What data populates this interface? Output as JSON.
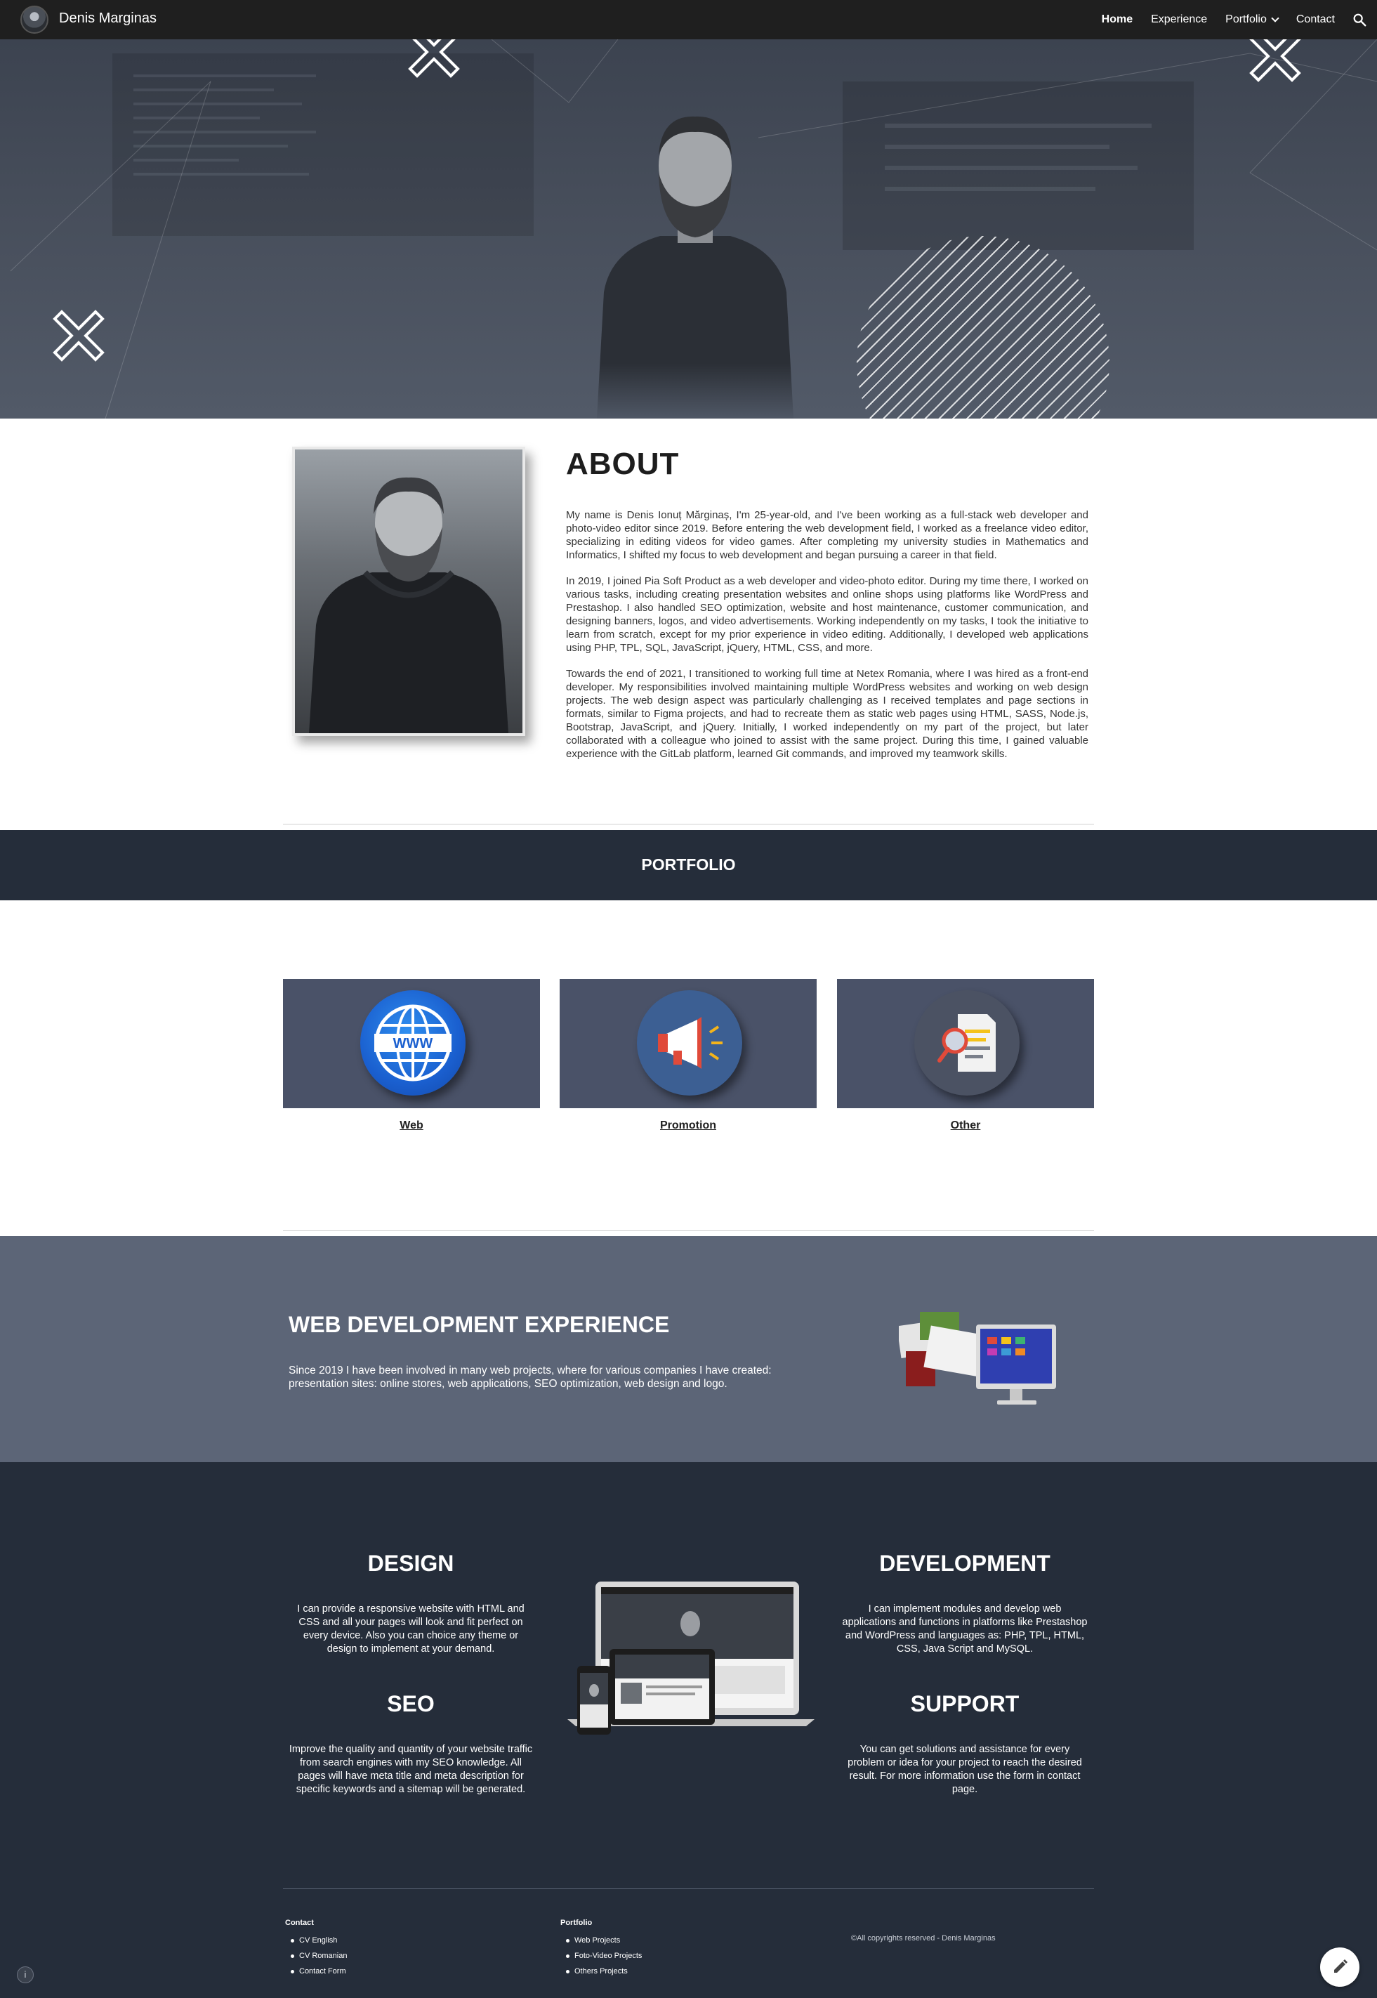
{
  "nav": {
    "brand": "Denis Marginas",
    "items": [
      {
        "label": "Home",
        "active": true
      },
      {
        "label": "Experience",
        "active": false
      },
      {
        "label": "Portfolio",
        "active": false,
        "has_dropdown": true
      },
      {
        "label": "Contact",
        "active": false
      }
    ],
    "search_icon": "search-icon"
  },
  "about": {
    "title": "ABOUT",
    "paragraphs": [
      "My name is Denis Ionuț Mărginaș, I'm 25-year-old, and I've been working as a full-stack web developer and photo-video editor since 2019. Before entering the web development field, I worked as a freelance video editor, specializing in editing videos for video games. After completing my university studies in Mathematics and Informatics, I shifted my focus to web development and began pursuing a career in that field.",
      "In 2019, I joined Pia Soft Product as a web developer and video-photo editor. During my time there, I worked on various tasks, including creating presentation websites and online shops using platforms like WordPress and Prestashop. I also handled SEO optimization, website and host maintenance, customer communication, and designing banners, logos, and video advertisements. Working independently on my tasks, I took the initiative to learn from scratch, except for my prior experience in video editing. Additionally, I developed web applications using PHP, TPL, SQL, JavaScript, jQuery, HTML, CSS, and more.",
      "Towards the end of 2021, I transitioned to working full time at Netex Romania, where I was hired as a front-end developer. My responsibilities involved maintaining multiple WordPress websites and working on web design projects. The web design aspect was particularly challenging as I received templates and page sections in formats, similar to Figma projects, and had to recreate them as static web pages using HTML, SASS, Node.js, Bootstrap, JavaScript, and jQuery. Initially, I worked independently on my part of the project, but later collaborated with a colleague who joined to assist with the same project. During this time, I gained valuable experience with the GitLab platform, learned Git commands, and improved my teamwork skills."
    ]
  },
  "portfolio": {
    "title": "PORTFOLIO",
    "cards": [
      {
        "label": "Web",
        "icon": "globe-www-icon"
      },
      {
        "label": "Promotion",
        "icon": "megaphone-icon"
      },
      {
        "label": "Other",
        "icon": "document-search-icon"
      }
    ]
  },
  "experience": {
    "title": "WEB DEVELOPMENT EXPERIENCE",
    "text": "Since 2019 I have been involved in many web projects, where for various companies I have created: presentation sites: online stores, web applications, SEO optimization, web design and logo."
  },
  "services": {
    "design": {
      "title": "DESIGN",
      "text": "I can provide a responsive website with HTML and CSS and all your pages will look and fit perfect on every device. Also you can choice any theme or design to implement at your demand."
    },
    "development": {
      "title": "DEVELOPMENT",
      "text": "I can implement modules and develop web applications and functions in platforms like Prestashop and WordPress and languages as: PHP, TPL, HTML, CSS, Java Script and MySQL."
    },
    "seo": {
      "title": "SEO",
      "text": "Improve the quality and quantity of your website traffic from search engines with my SEO knowledge. All pages will have meta title and meta description for specific keywords and a sitemap will be generated."
    },
    "support": {
      "title": "SUPPORT",
      "text": "You can get solutions and assistance for every problem or idea for your project to reach the desired result. For more information use the form in contact page."
    }
  },
  "footer": {
    "contact": {
      "title": "Contact",
      "links": [
        "CV English",
        "CV Romanian",
        "Contact Form"
      ]
    },
    "portfolio": {
      "title": "Portfolio",
      "links": [
        "Web Projects",
        "Foto-Video Projects",
        "Others Projects"
      ]
    },
    "copyright": "©All copyrights reserved - Denis Marginas"
  },
  "colors": {
    "nav_bg": "#1f1f1f",
    "dark_band": "#252d3a",
    "experience_bg": "#5c6577",
    "card_bg": "#4a5268"
  }
}
